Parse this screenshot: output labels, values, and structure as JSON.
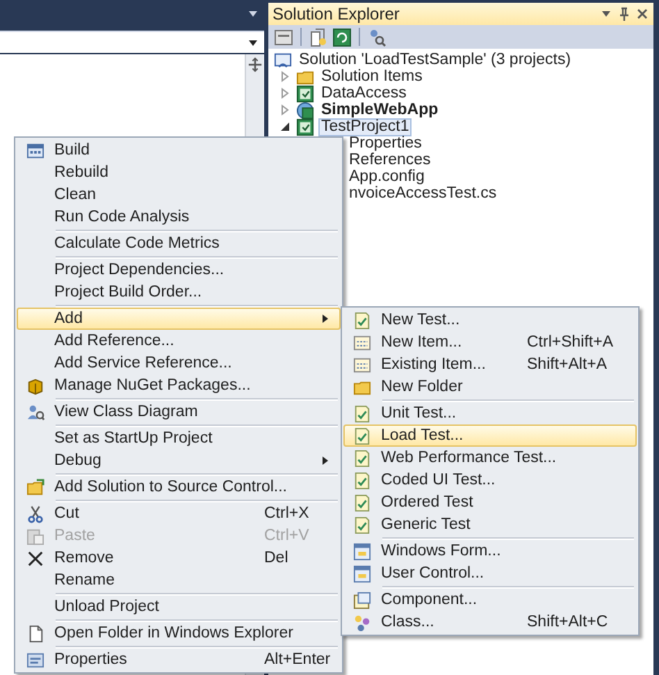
{
  "solution_explorer": {
    "title": "Solution Explorer",
    "tree": [
      {
        "label": "Solution 'LoadTestSample' (3 projects)",
        "bold": false,
        "selected": false,
        "children": [
          {
            "label": "Solution Items",
            "expanded": false,
            "bold": false,
            "selected": false
          },
          {
            "label": "DataAccess",
            "expanded": false,
            "bold": false,
            "selected": false
          },
          {
            "label": "SimpleWebApp",
            "expanded": false,
            "bold": true,
            "selected": false
          },
          {
            "label": "TestProject1",
            "expanded": true,
            "bold": false,
            "selected": true,
            "children": [
              {
                "label": "Properties",
                "bold": false,
                "selected": false
              },
              {
                "label": "References",
                "bold": false,
                "selected": false
              },
              {
                "label": "App.config",
                "bold": false,
                "selected": false
              },
              {
                "label": "nvoiceAccessTest.cs",
                "bold": false,
                "selected": false
              }
            ]
          }
        ]
      }
    ]
  },
  "context_menu": {
    "items": [
      {
        "kind": "item",
        "label": "Build",
        "selected": false,
        "disabled": false,
        "submenu": false
      },
      {
        "kind": "item",
        "label": "Rebuild",
        "selected": false,
        "disabled": false,
        "submenu": false
      },
      {
        "kind": "item",
        "label": "Clean",
        "selected": false,
        "disabled": false,
        "submenu": false
      },
      {
        "kind": "item",
        "label": "Run Code Analysis",
        "selected": false,
        "disabled": false,
        "submenu": false
      },
      {
        "kind": "separator"
      },
      {
        "kind": "item",
        "label": "Calculate Code Metrics",
        "selected": false,
        "disabled": false,
        "submenu": false
      },
      {
        "kind": "separator"
      },
      {
        "kind": "item",
        "label": "Project Dependencies...",
        "selected": false,
        "disabled": false,
        "submenu": false
      },
      {
        "kind": "item",
        "label": "Project Build Order...",
        "selected": false,
        "disabled": false,
        "submenu": false
      },
      {
        "kind": "separator"
      },
      {
        "kind": "item",
        "label": "Add",
        "selected": true,
        "disabled": false,
        "submenu": true
      },
      {
        "kind": "item",
        "label": "Add Reference...",
        "selected": false,
        "disabled": false,
        "submenu": false
      },
      {
        "kind": "item",
        "label": "Add Service Reference...",
        "selected": false,
        "disabled": false,
        "submenu": false
      },
      {
        "kind": "item",
        "label": "Manage NuGet Packages...",
        "selected": false,
        "disabled": false,
        "submenu": false
      },
      {
        "kind": "separator"
      },
      {
        "kind": "item",
        "label": "View Class Diagram",
        "selected": false,
        "disabled": false,
        "submenu": false
      },
      {
        "kind": "separator"
      },
      {
        "kind": "item",
        "label": "Set as StartUp Project",
        "selected": false,
        "disabled": false,
        "submenu": false
      },
      {
        "kind": "item",
        "label": "Debug",
        "selected": false,
        "disabled": false,
        "submenu": true
      },
      {
        "kind": "separator"
      },
      {
        "kind": "item",
        "label": "Add Solution to Source Control...",
        "selected": false,
        "disabled": false,
        "submenu": false
      },
      {
        "kind": "separator"
      },
      {
        "kind": "item",
        "label": "Cut",
        "shortcut": "Ctrl+X",
        "selected": false,
        "disabled": false,
        "submenu": false
      },
      {
        "kind": "item",
        "label": "Paste",
        "shortcut": "Ctrl+V",
        "selected": false,
        "disabled": true,
        "submenu": false
      },
      {
        "kind": "item",
        "label": "Remove",
        "shortcut": "Del",
        "selected": false,
        "disabled": false,
        "submenu": false
      },
      {
        "kind": "item",
        "label": "Rename",
        "selected": false,
        "disabled": false,
        "submenu": false
      },
      {
        "kind": "separator"
      },
      {
        "kind": "item",
        "label": "Unload Project",
        "selected": false,
        "disabled": false,
        "submenu": false
      },
      {
        "kind": "separator"
      },
      {
        "kind": "item",
        "label": "Open Folder in Windows Explorer",
        "selected": false,
        "disabled": false,
        "submenu": false
      },
      {
        "kind": "separator"
      },
      {
        "kind": "item",
        "label": "Properties",
        "shortcut": "Alt+Enter",
        "selected": false,
        "disabled": false,
        "submenu": false
      }
    ]
  },
  "add_submenu": {
    "items": [
      {
        "kind": "item",
        "label": "New Test...",
        "selected": false
      },
      {
        "kind": "item",
        "label": "New Item...",
        "shortcut": "Ctrl+Shift+A",
        "selected": false
      },
      {
        "kind": "item",
        "label": "Existing Item...",
        "shortcut": "Shift+Alt+A",
        "selected": false
      },
      {
        "kind": "item",
        "label": "New Folder",
        "selected": false
      },
      {
        "kind": "separator"
      },
      {
        "kind": "item",
        "label": "Unit Test...",
        "selected": false
      },
      {
        "kind": "item",
        "label": "Load Test...",
        "selected": true
      },
      {
        "kind": "item",
        "label": "Web Performance Test...",
        "selected": false
      },
      {
        "kind": "item",
        "label": "Coded UI Test...",
        "selected": false
      },
      {
        "kind": "item",
        "label": "Ordered Test",
        "selected": false
      },
      {
        "kind": "item",
        "label": "Generic Test",
        "selected": false
      },
      {
        "kind": "separator"
      },
      {
        "kind": "item",
        "label": "Windows Form...",
        "selected": false
      },
      {
        "kind": "item",
        "label": "User Control...",
        "selected": false
      },
      {
        "kind": "separator"
      },
      {
        "kind": "item",
        "label": "Component...",
        "selected": false
      },
      {
        "kind": "item",
        "label": "Class...",
        "shortcut": "Shift+Alt+C",
        "selected": false
      }
    ]
  }
}
